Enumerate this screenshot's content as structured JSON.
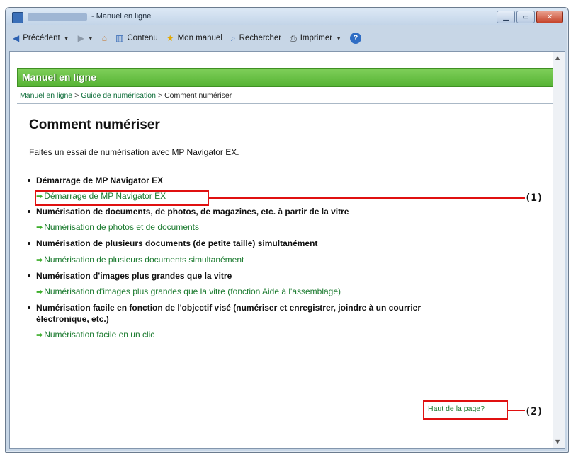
{
  "window": {
    "title": "- Manuel en ligne"
  },
  "toolbar": {
    "back_label": "Précédent",
    "contents_label": "Contenu",
    "my_manual_label": "Mon manuel",
    "search_label": "Rechercher",
    "print_label": "Imprimer"
  },
  "page": {
    "header_title": "Manuel en ligne",
    "breadcrumb": {
      "crumb1": "Manuel en ligne",
      "crumb2": "Guide de numérisation",
      "current": "Comment numériser",
      "separator": ">"
    },
    "title": "Comment numériser",
    "intro": "Faites un essai de numérisation avec MP Navigator EX.",
    "items": [
      {
        "title": "Démarrage de MP Navigator EX",
        "link": "Démarrage de MP Navigator EX"
      },
      {
        "title": "Numérisation de documents, de photos, de magazines, etc. à partir de la vitre",
        "link": "Numérisation de photos et de documents"
      },
      {
        "title": "Numérisation de plusieurs documents (de petite taille) simultanément",
        "link": "Numérisation de plusieurs documents simultanément"
      },
      {
        "title": "Numérisation d'images plus grandes que la vitre",
        "link": "Numérisation d'images plus grandes que la vitre (fonction Aide à l'assemblage)"
      },
      {
        "title_line1": "Numérisation facile en fonction de l'objectif visé (numériser et enregistrer, joindre à un courrier",
        "title_line2": "électronique, etc.)",
        "link": "Numérisation facile en un clic"
      }
    ],
    "top_link": "Haut de la page?"
  },
  "callouts": {
    "one": "(1)",
    "two": "(2)"
  }
}
